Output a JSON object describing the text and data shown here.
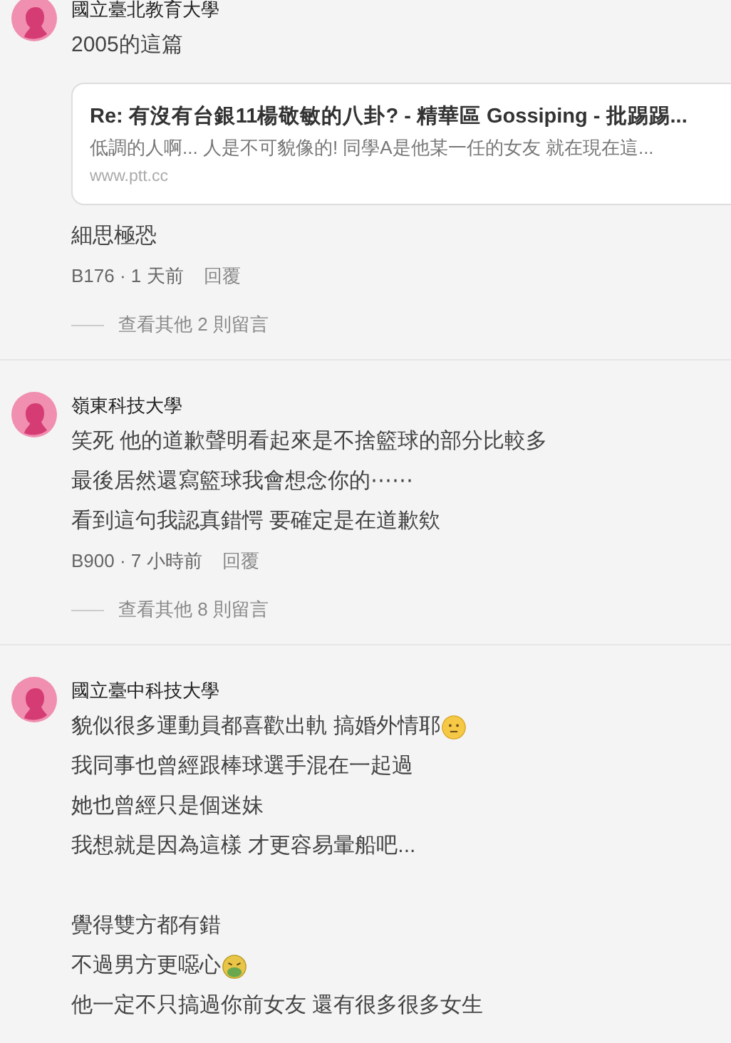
{
  "comments": [
    {
      "school": "國立臺北教育大學",
      "blocks": [
        {
          "kind": "text",
          "text": "2005的這篇"
        },
        {
          "kind": "link_card",
          "title": "Re: 有沒有台銀11楊敬敏的八卦? - 精華區 Gossiping - 批踢踢...",
          "description": "低調的人啊... 人是不可貌像的! 同學A是他某一任的女友 就在現在這...",
          "url": "www.ptt.cc"
        },
        {
          "kind": "text",
          "text": "細思極恐"
        }
      ],
      "byline": "B176 · 1 天前",
      "reply": "回覆",
      "more": "查看其他 2 則留言"
    },
    {
      "school": "嶺東科技大學",
      "blocks": [
        {
          "kind": "text",
          "text": "笑死 他的道歉聲明看起來是不捨籃球的部分比較多"
        },
        {
          "kind": "text",
          "text": "最後居然還寫籃球我會想念你的⋯⋯"
        },
        {
          "kind": "text",
          "text": "看到這句我認真錯愕 要確定是在道歉欸"
        }
      ],
      "byline": "B900 · 7 小時前",
      "reply": "回覆",
      "more": "查看其他 8 則留言"
    },
    {
      "school": "國立臺中科技大學",
      "blocks": [
        {
          "kind": "text",
          "text": "貌似很多運動員都喜歡出軌 搞婚外情耶",
          "trailing": {
            "kind": "neutral_face"
          }
        },
        {
          "kind": "text",
          "text": "我同事也曾經跟棒球選手混在一起過"
        },
        {
          "kind": "text",
          "text": "她也曾經只是個迷妹"
        },
        {
          "kind": "text",
          "text": "我想就是因為這樣 才更容易暈船吧..."
        },
        {
          "kind": "gap"
        },
        {
          "kind": "text",
          "text": "覺得雙方都有錯"
        },
        {
          "kind": "text",
          "text": "不過男方更噁心",
          "trailing": {
            "kind": "nauseated_face"
          }
        },
        {
          "kind": "text",
          "text": "他一定不只搞過你前女友 還有很多很多女生"
        }
      ]
    }
  ]
}
